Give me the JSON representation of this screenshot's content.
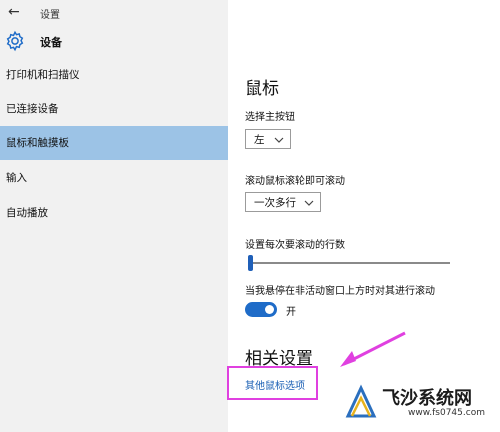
{
  "window": {
    "title": "设置"
  },
  "header": {
    "title": "设备"
  },
  "sidebar": {
    "items": [
      {
        "label": "打印机和扫描仪"
      },
      {
        "label": "已连接设备"
      },
      {
        "label": "鼠标和触摸板"
      },
      {
        "label": "输入"
      },
      {
        "label": "自动播放"
      }
    ],
    "active_index": 2
  },
  "main": {
    "section_title": "鼠标",
    "primary_button": {
      "label": "选择主按钮",
      "value": "左"
    },
    "scroll_mode": {
      "label": "滚动鼠标滚轮即可滚动",
      "value": "一次多行"
    },
    "lines_to_scroll": {
      "label": "设置每次要滚动的行数",
      "value": 1
    },
    "inactive_scroll": {
      "label": "当我悬停在非活动窗口上方时对其进行滚动",
      "state_label": "开"
    },
    "related_title": "相关设置",
    "related_link": "其他鼠标选项"
  },
  "annotation": {
    "box_color": "#e040e0",
    "arrow_color": "#e040e0"
  },
  "watermark": {
    "text": "飞沙系统网",
    "url": "www.fs0745.com"
  },
  "colors": {
    "active_nav": "#9cc3e6",
    "toggle_on": "#1f6cc8",
    "link": "#1a5fb4"
  }
}
